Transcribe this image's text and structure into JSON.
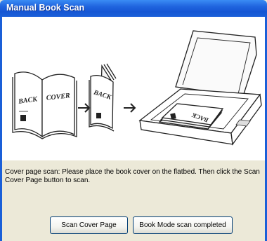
{
  "window": {
    "title": "Manual Book Scan"
  },
  "illustration": {
    "book_back_label": "BACK",
    "book_cover_label": "COVER",
    "book_folded_label": "BACK",
    "book_on_scanner_label": "BACK"
  },
  "instruction_text": "Cover page scan: Please place the book cover on the flatbed. Then click the Scan Cover Page button to scan.",
  "buttons": {
    "scan_cover_label": "Scan Cover Page",
    "book_mode_label": "Book Mode scan completed"
  },
  "colors": {
    "titlebar": "#1f63de",
    "dialog_bg": "#ece9d8",
    "button_border": "#003c74"
  }
}
